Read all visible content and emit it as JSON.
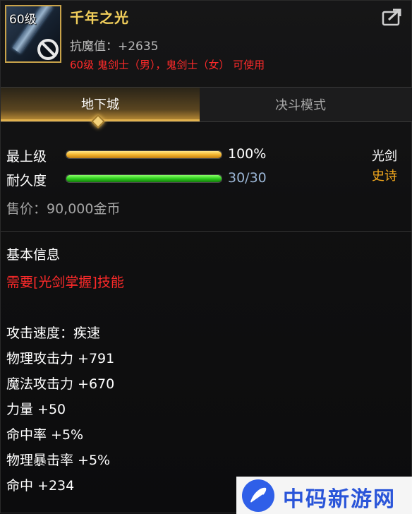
{
  "item": {
    "level": "60级",
    "name": "千年之光",
    "stat": "抗魔值：+2635",
    "requirement": "60级 鬼剑士（男），鬼剑士（女） 可使用"
  },
  "tabs": [
    {
      "label": "地下城",
      "active": true
    },
    {
      "label": "决斗模式",
      "active": false
    }
  ],
  "bars": {
    "level": {
      "label": "最上级",
      "value_text": "100%",
      "fraction": 1.0
    },
    "durability": {
      "label": "耐久度",
      "value_text": "30/30",
      "fraction": 1.0
    }
  },
  "weapon_type": "光剑",
  "rarity": "史诗",
  "price": "售价：90,000金币",
  "basic_info_title": "基本信息",
  "skill_requirement": "需要[光剑掌握]技能",
  "stats": [
    "攻击速度：疾速",
    "物理攻击力 +791",
    "魔法攻击力 +670",
    "力量 +50",
    "命中率 +5%",
    "物理暴击率 +5%",
    "命中 +234"
  ],
  "watermark": "中码新游网",
  "colors": {
    "name_gold": "#f2cf5b",
    "requirement_red": "#ff2a2a",
    "rarity_orange": "#f2a81d",
    "durability_blue": "#9bb6d6"
  },
  "icons": {
    "item_icon": "lightsaber-item-icon",
    "restriction": "no-entry-icon",
    "share": "share-icon",
    "tab_marker": "diamond-marker-icon"
  }
}
